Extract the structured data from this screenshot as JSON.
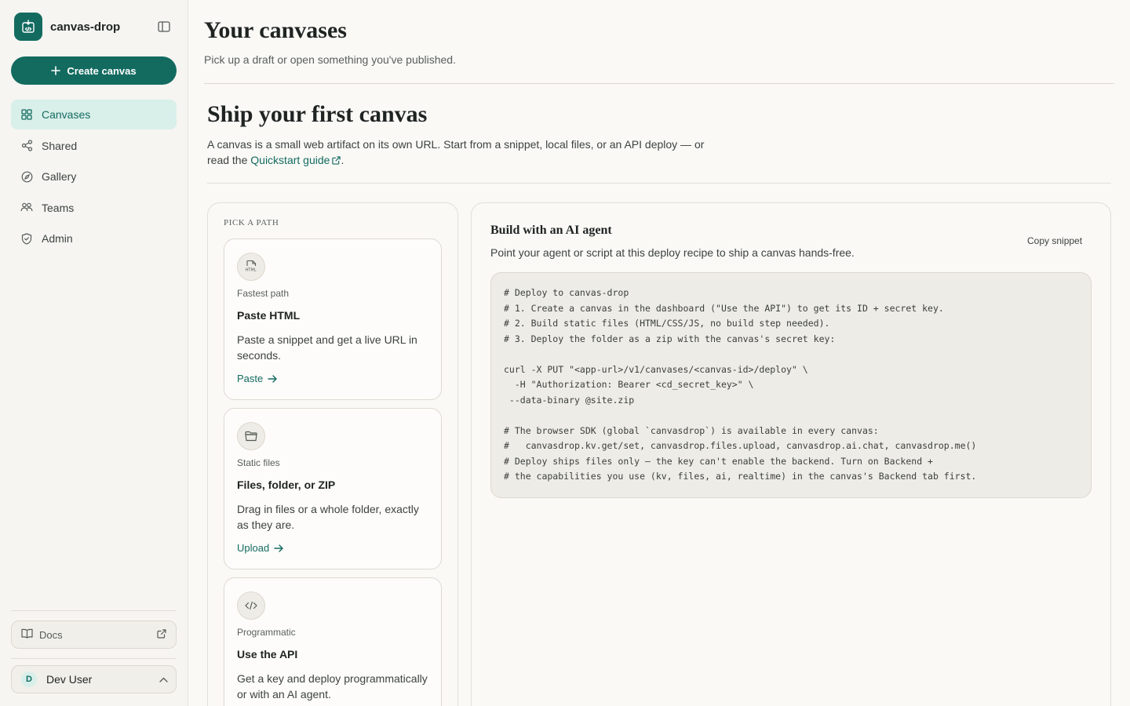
{
  "sidebar": {
    "brand_name": "canvas-drop",
    "create_label": "Create canvas",
    "items": [
      {
        "label": "Canvases",
        "icon": "grid-icon"
      },
      {
        "label": "Shared",
        "icon": "share-icon"
      },
      {
        "label": "Gallery",
        "icon": "compass-icon"
      },
      {
        "label": "Teams",
        "icon": "users-icon"
      },
      {
        "label": "Admin",
        "icon": "shield-icon"
      }
    ],
    "active_item": "Canvases",
    "docs_label": "Docs",
    "user": {
      "initial": "D",
      "name": "Dev User"
    }
  },
  "header": {
    "title": "Your canvases",
    "subtitle": "Pick up a draft or open something you've published."
  },
  "ship": {
    "title": "Ship your first canvas",
    "desc_before": "A canvas is a small web artifact on its own URL. Start from a snippet, local files, or an API deploy — or read the ",
    "link_label": "Quickstart guide",
    "desc_after": "."
  },
  "paths": {
    "label": "PICK A PATH",
    "cards": [
      {
        "icon": "html-file-icon",
        "kicker": "Fastest path",
        "title": "Paste HTML",
        "desc": "Paste a snippet and get a live URL in seconds.",
        "action": "Paste"
      },
      {
        "icon": "folder-icon",
        "kicker": "Static files",
        "title": "Files, folder, or ZIP",
        "desc": "Drag in files or a whole folder, exactly as they are.",
        "action": "Upload"
      },
      {
        "icon": "code-icon",
        "kicker": "Programmatic",
        "title": "Use the API",
        "desc": "Get a key and deploy programmatically or with an AI agent.",
        "action": ""
      }
    ]
  },
  "agent": {
    "title": "Build with an AI agent",
    "subtitle": "Point your agent or script at this deploy recipe to ship a canvas hands-free.",
    "copy_label": "Copy snippet",
    "code_lines": [
      "# Deploy to canvas-drop",
      "# 1. Create a canvas in the dashboard (\"Use the API\") to get its ID + secret key.",
      "# 2. Build static files (HTML/CSS/JS, no build step needed).",
      "# 3. Deploy the folder as a zip with the canvas's secret key:",
      "",
      "curl -X PUT \"<app-url>/v1/canvases/<canvas-id>/deploy\" \\",
      "  -H \"Authorization: Bearer <cd_secret_key>\" \\",
      " --data-binary @site.zip",
      "",
      "# The browser SDK (global `canvasdrop`) is available in every canvas:",
      "#   canvasdrop.kv.get/set, canvasdrop.files.upload, canvasdrop.ai.chat, canvasdrop.me()",
      "# Deploy ships files only — the key can't enable the backend. Turn on Backend +",
      "# the capabilities you use (kv, files, ai, realtime) in the canvas's Backend tab first."
    ]
  },
  "colors": {
    "accent": "#136b60",
    "accent_soft": "#d9efea",
    "background": "#faf9f6"
  }
}
